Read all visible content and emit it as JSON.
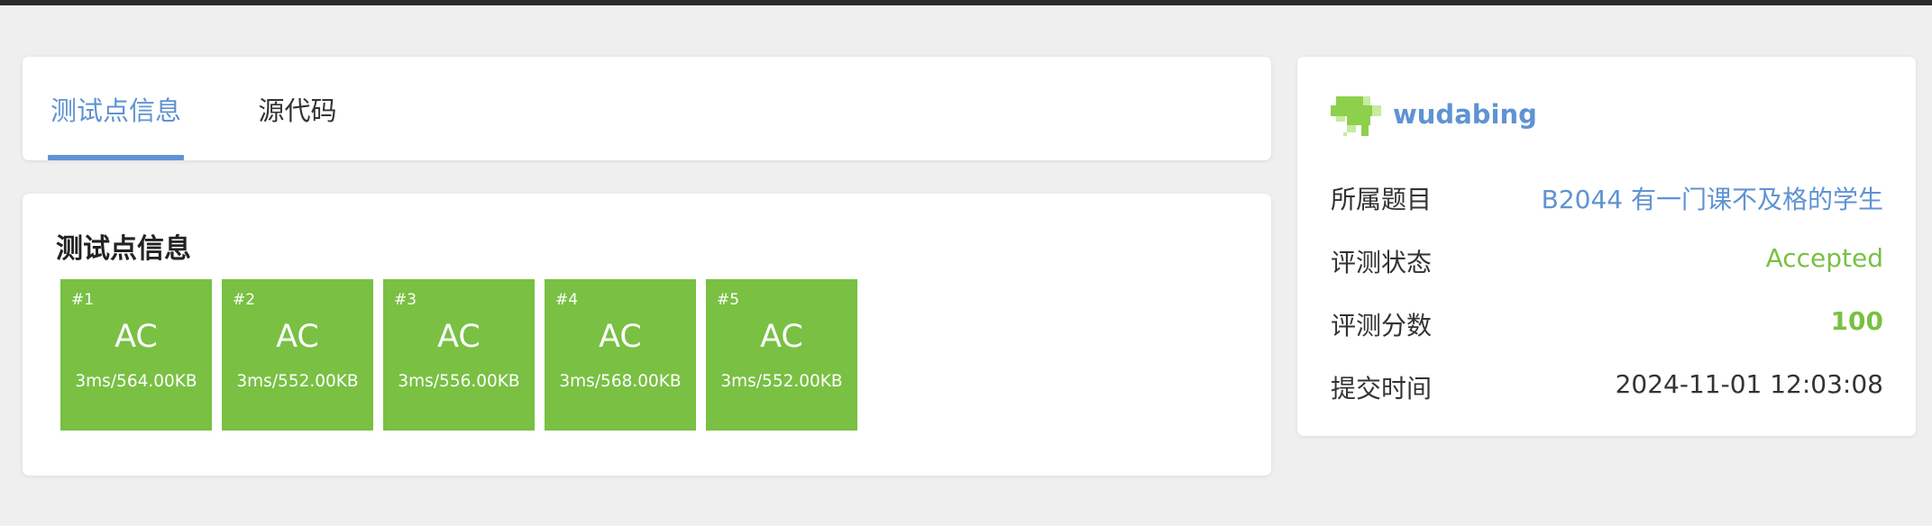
{
  "tabs": [
    {
      "label": "测试点信息",
      "active": true
    },
    {
      "label": "源代码",
      "active": false
    }
  ],
  "tests": {
    "title": "测试点信息",
    "cases": [
      {
        "num": "#1",
        "status": "AC",
        "info": "3ms/564.00KB"
      },
      {
        "num": "#2",
        "status": "AC",
        "info": "3ms/552.00KB"
      },
      {
        "num": "#3",
        "status": "AC",
        "info": "3ms/556.00KB"
      },
      {
        "num": "#4",
        "status": "AC",
        "info": "3ms/568.00KB"
      },
      {
        "num": "#5",
        "status": "AC",
        "info": "3ms/552.00KB"
      }
    ]
  },
  "submission": {
    "username": "wudabing",
    "avatar_icon": "identicon-avatar",
    "problem_label": "所属题目",
    "problem_value": "B2044 有一门课不及格的学生",
    "status_label": "评测状态",
    "status_value": "Accepted",
    "score_label": "评测分数",
    "score_value": "100",
    "time_label": "提交时间",
    "time_value": "2024-11-01 12:03:08"
  },
  "colors": {
    "accent": "#5f93d3",
    "accepted": "#79c043",
    "background": "#efefef",
    "topbar": "#2b2b2b"
  }
}
